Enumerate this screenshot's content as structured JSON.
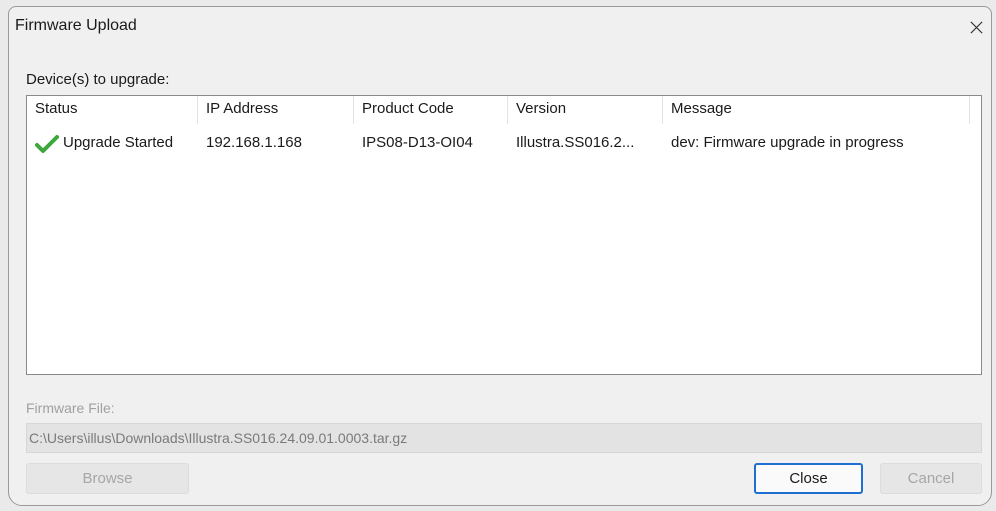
{
  "window": {
    "title": "Firmware Upload",
    "close_glyph": "close-icon"
  },
  "devices": {
    "label": "Device(s) to upgrade:",
    "columns": [
      "Status",
      "IP Address",
      "Product Code",
      "Version",
      "Message"
    ],
    "rows": [
      {
        "status_icon": "checkmark-icon",
        "status": "Upgrade Started",
        "ip": "192.168.1.168",
        "product_code": "IPS08-D13-OI04",
        "version": "Illustra.SS016.2...",
        "message": "dev: Firmware upgrade in progress"
      }
    ]
  },
  "firmware": {
    "label": "Firmware File:",
    "path": "C:\\Users\\illus\\Downloads\\Illustra.SS016.24.09.01.0003.tar.gz"
  },
  "buttons": {
    "browse": "Browse",
    "close": "Close",
    "cancel": "Cancel"
  },
  "colors": {
    "accent": "#1f6fd0",
    "check": "#3aa83a"
  }
}
